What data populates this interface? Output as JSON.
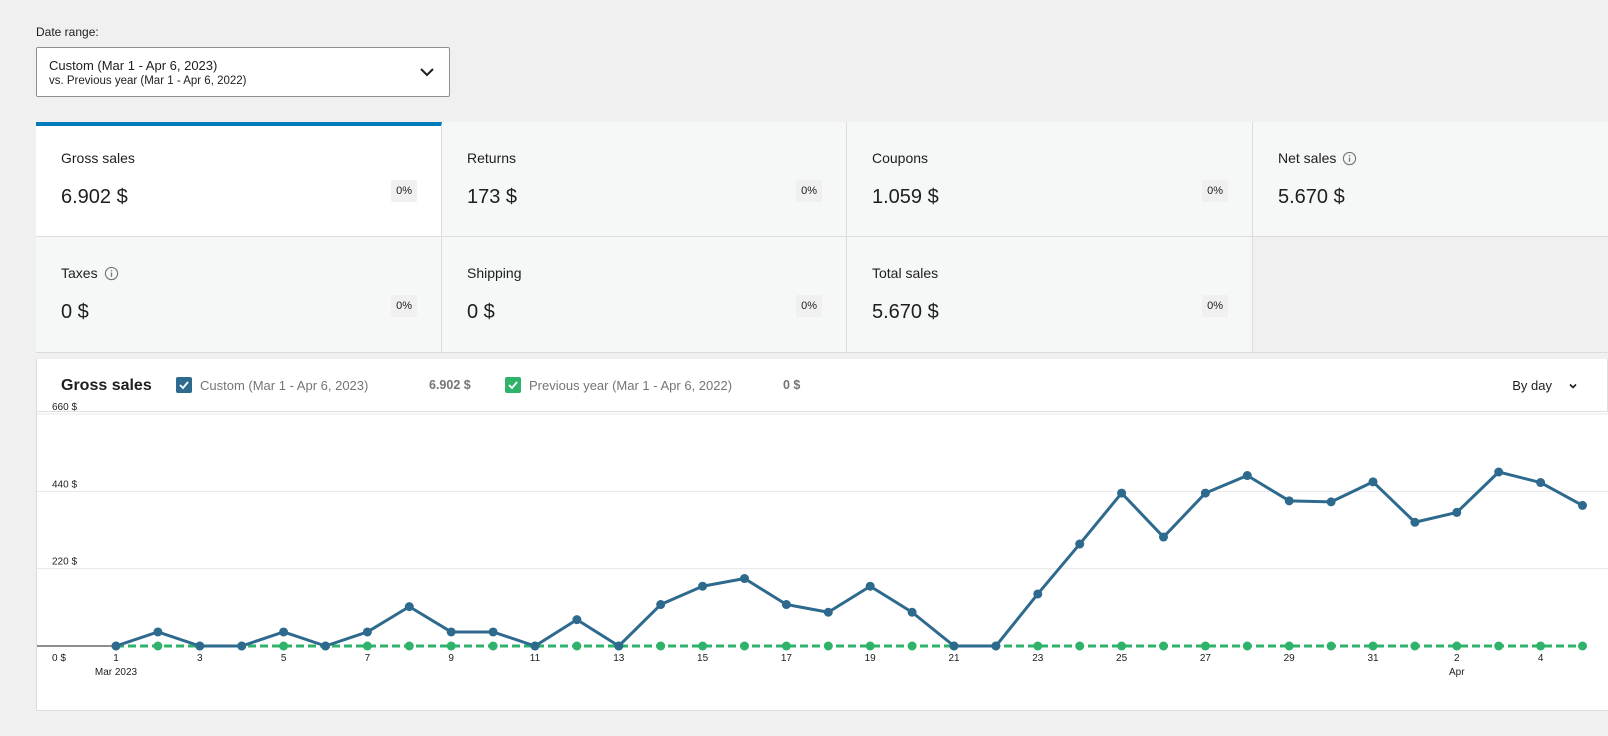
{
  "date_range": {
    "label": "Date range:",
    "primary": "Custom (Mar 1 - Apr 6, 2023)",
    "secondary": "vs. Previous year (Mar 1 - Apr 6, 2022)",
    "icon": "chevron-down-icon"
  },
  "summary": [
    {
      "label": "Gross sales",
      "value": "6.902 $",
      "delta": "0%",
      "info": false,
      "selected": true
    },
    {
      "label": "Returns",
      "value": "173 $",
      "delta": "0%",
      "info": false
    },
    {
      "label": "Coupons",
      "value": "1.059 $",
      "delta": "0%",
      "info": false
    },
    {
      "label": "Net sales",
      "value": "5.670 $",
      "delta": "",
      "info": true
    },
    {
      "label": "Taxes",
      "value": "0 $",
      "delta": "0%",
      "info": true
    },
    {
      "label": "Shipping",
      "value": "0 $",
      "delta": "0%",
      "info": false
    },
    {
      "label": "Total sales",
      "value": "5.670 $",
      "delta": "0%",
      "info": false
    }
  ],
  "chart": {
    "title": "Gross sales",
    "legend": [
      {
        "label": "Custom (Mar 1 - Apr 6, 2023)",
        "total": "6.902 $",
        "color": "#2d6a8e"
      },
      {
        "label": "Previous year (Mar 1 - Apr 6, 2022)",
        "total": "0 $",
        "color": "#2fb36b"
      }
    ],
    "interval_label": "By day",
    "colors": {
      "accent": "#007cba",
      "current": "#2d6a8e",
      "previous": "#2fb36b"
    }
  },
  "chart_data": {
    "type": "line",
    "title": "Gross sales",
    "xlabel": "",
    "ylabel": "",
    "ylim": [
      0,
      660
    ],
    "yticks": [
      "0 $",
      "220 $",
      "440 $",
      "660 $"
    ],
    "y_tick_values": [
      0,
      220,
      440,
      660
    ],
    "x": [
      "Mar 1",
      "Mar 2",
      "Mar 3",
      "Mar 4",
      "Mar 5",
      "Mar 6",
      "Mar 7",
      "Mar 8",
      "Mar 9",
      "Mar 10",
      "Mar 11",
      "Mar 12",
      "Mar 13",
      "Mar 14",
      "Mar 15",
      "Mar 16",
      "Mar 17",
      "Mar 18",
      "Mar 19",
      "Mar 20",
      "Mar 21",
      "Mar 22",
      "Mar 23",
      "Mar 24",
      "Mar 25",
      "Mar 26",
      "Mar 27",
      "Mar 28",
      "Mar 29",
      "Mar 30",
      "Mar 31",
      "Apr 1",
      "Apr 2",
      "Apr 3",
      "Apr 4",
      "Apr 5"
    ],
    "xtick_labels": [
      "1",
      "",
      "3",
      "",
      "5",
      "",
      "7",
      "",
      "9",
      "",
      "11",
      "",
      "13",
      "",
      "15",
      "",
      "17",
      "",
      "19",
      "",
      "21",
      "",
      "23",
      "",
      "25",
      "",
      "27",
      "",
      "29",
      "",
      "31",
      "",
      "2",
      "",
      "4",
      ""
    ],
    "xtick_sublabels": {
      "0": "Mar 2023",
      "32": "Apr"
    },
    "series": [
      {
        "name": "Custom (Mar 1 - Apr 6, 2023)",
        "values": [
          0,
          40,
          0,
          0,
          40,
          0,
          40,
          112,
          40,
          40,
          0,
          75,
          0,
          118,
          170,
          192,
          118,
          96,
          170,
          96,
          0,
          0,
          148,
          290,
          435,
          310,
          435,
          485,
          413,
          410,
          467,
          352,
          380,
          495,
          465,
          400
        ]
      },
      {
        "name": "Previous year (Mar 1 - Apr 6, 2022)",
        "values": [
          0,
          0,
          0,
          0,
          0,
          0,
          0,
          0,
          0,
          0,
          0,
          0,
          0,
          0,
          0,
          0,
          0,
          0,
          0,
          0,
          0,
          0,
          0,
          0,
          0,
          0,
          0,
          0,
          0,
          0,
          0,
          0,
          0,
          0,
          0,
          0
        ]
      }
    ],
    "grid": true,
    "legend": "top"
  }
}
